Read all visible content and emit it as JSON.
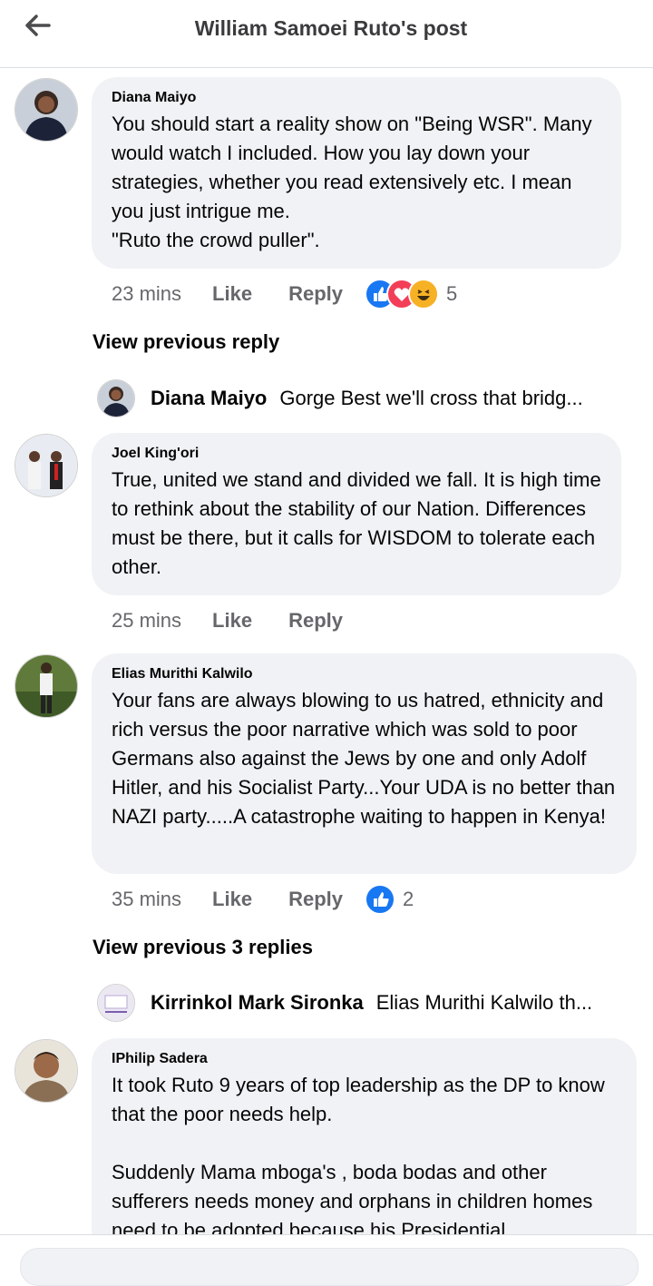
{
  "header": {
    "title": "William Samoei Ruto's post"
  },
  "comments": [
    {
      "author": "Diana Maiyo",
      "text": "You should start a reality show on \"Being WSR\". Many would watch I included. How you lay down your strategies, whether you read extensively etc. I mean you  just intrigue me.\n\"Ruto the crowd puller\".",
      "time": "23 mins",
      "like": "Like",
      "reply": "Reply",
      "reaction_count": "5",
      "view_previous": "View previous reply",
      "preview": {
        "name": "Diana Maiyo",
        "text": "Gorge Best we'll cross that bridg..."
      }
    },
    {
      "author": "Joel King'ori",
      "text": "True, united we stand and divided we fall. It is high time to rethink about the stability of our Nation. Differences must be there, but it calls for WISDOM to tolerate each other.",
      "time": "25 mins",
      "like": "Like",
      "reply": "Reply"
    },
    {
      "author": "Elias Murithi Kalwilo",
      "text": "Your fans are always blowing to us hatred, ethnicity and rich versus the poor narrative which was sold to poor Germans also against the Jews by one and only Adolf Hitler, and his Socialist Party...Your UDA is no better than NAZI party.....A catastrophe waiting to happen in Kenya!",
      "time": "35 mins",
      "like": "Like",
      "reply": "Reply",
      "reaction_count": "2",
      "view_previous": "View previous 3 replies",
      "preview": {
        "name": "Kirrinkol Mark Sironka",
        "text": "Elias Murithi Kalwilo th..."
      }
    },
    {
      "author": "IPhilip Sadera",
      "text": "It took Ruto 9 years of top leadership as the DP to know that the poor needs help.\n\nSuddenly Mama mboga's , boda bodas and other sufferers needs money and orphans in children homes need to be adopted because his Presidential"
    }
  ],
  "colors": {
    "like_blue": "#1877f2",
    "love_red": "#f33e58",
    "haha_yellow": "#f7b125",
    "bubble_bg": "#f0f2f5",
    "meta_gray": "#65676b"
  },
  "icons": {
    "back": "arrow-left-icon",
    "like": "like-reaction-icon",
    "love": "love-reaction-icon",
    "haha": "haha-reaction-icon"
  }
}
